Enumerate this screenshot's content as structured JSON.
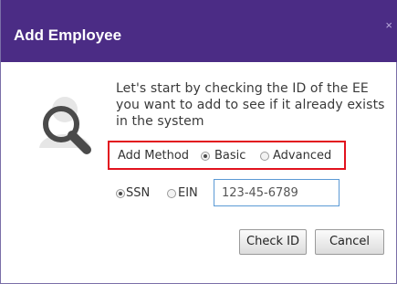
{
  "dialog": {
    "title": "Add Employee",
    "close_glyph": "×"
  },
  "icon": {
    "name": "employee-search-icon"
  },
  "intro": {
    "text": "Let's start by checking the ID of the EE you want to add to see if it already exists in the system"
  },
  "add_method": {
    "label": "Add Method",
    "options": [
      {
        "label": "Basic",
        "selected": true
      },
      {
        "label": "Advanced",
        "selected": false
      }
    ],
    "highlight_color": "#e2121e"
  },
  "id_type": {
    "options": [
      {
        "label": "SSN",
        "selected": true
      },
      {
        "label": "EIN",
        "selected": false
      }
    ]
  },
  "id_field": {
    "value": "123-45-6789"
  },
  "buttons": {
    "check_id": "Check ID",
    "cancel": "Cancel"
  },
  "colors": {
    "header_bg": "#4b2c85",
    "input_border": "#5b9ad5"
  }
}
